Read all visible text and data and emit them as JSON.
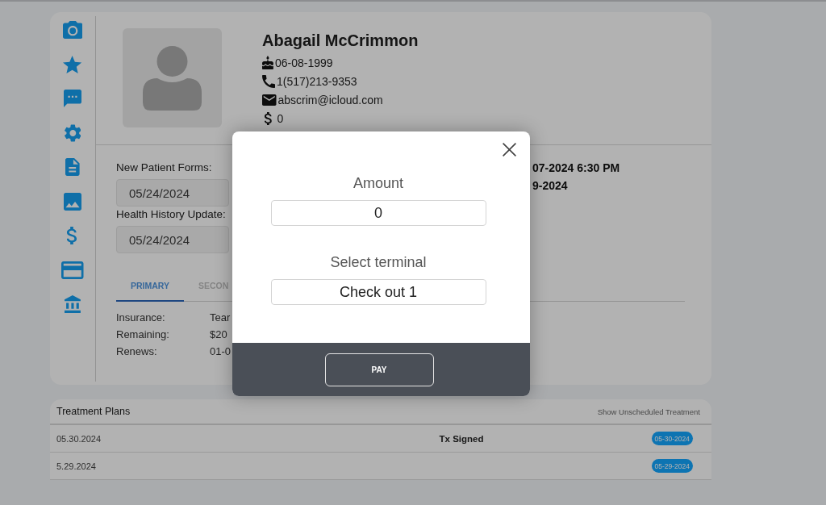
{
  "patient": {
    "name": "Abagail McCrimmon",
    "contacts": [
      {
        "kind": "birthday",
        "text": "06-08-1999"
      },
      {
        "kind": "phone",
        "text": "1(517)213-9353"
      },
      {
        "kind": "email",
        "text": "abscrim@icloud.com"
      },
      {
        "kind": "balance",
        "text": "0"
      }
    ]
  },
  "forms": [
    {
      "label": "New Patient Forms:",
      "value": "05/24/2024"
    },
    {
      "label": "Health History Update:",
      "value": "05/24/2024"
    }
  ],
  "details": [
    "07-2024 6:30 PM",
    "9-2024"
  ],
  "insurance_tabs": [
    {
      "label": "PRIMARY",
      "selected": true
    },
    {
      "label": "SECON",
      "selected": false
    }
  ],
  "insurance": [
    {
      "label": "Insurance:",
      "value": "Tear"
    },
    {
      "label": "Remaining:",
      "value": "$20"
    },
    {
      "label": "Renews:",
      "value": "01-0"
    }
  ],
  "treatment_plans": {
    "title": "Treatment Plans",
    "action": "Show Unscheduled Treatment",
    "rows": [
      {
        "date": "05.30.2024",
        "status": "Tx Signed",
        "badge": "05-30-2024"
      },
      {
        "date": "5.29.2024",
        "badge": "05-29-2024"
      }
    ]
  },
  "payment_dialog": {
    "fields": [
      {
        "label": "Amount",
        "value": "0"
      },
      {
        "label": "Select terminal",
        "value": "Check out 1"
      }
    ],
    "button": "PAY"
  }
}
